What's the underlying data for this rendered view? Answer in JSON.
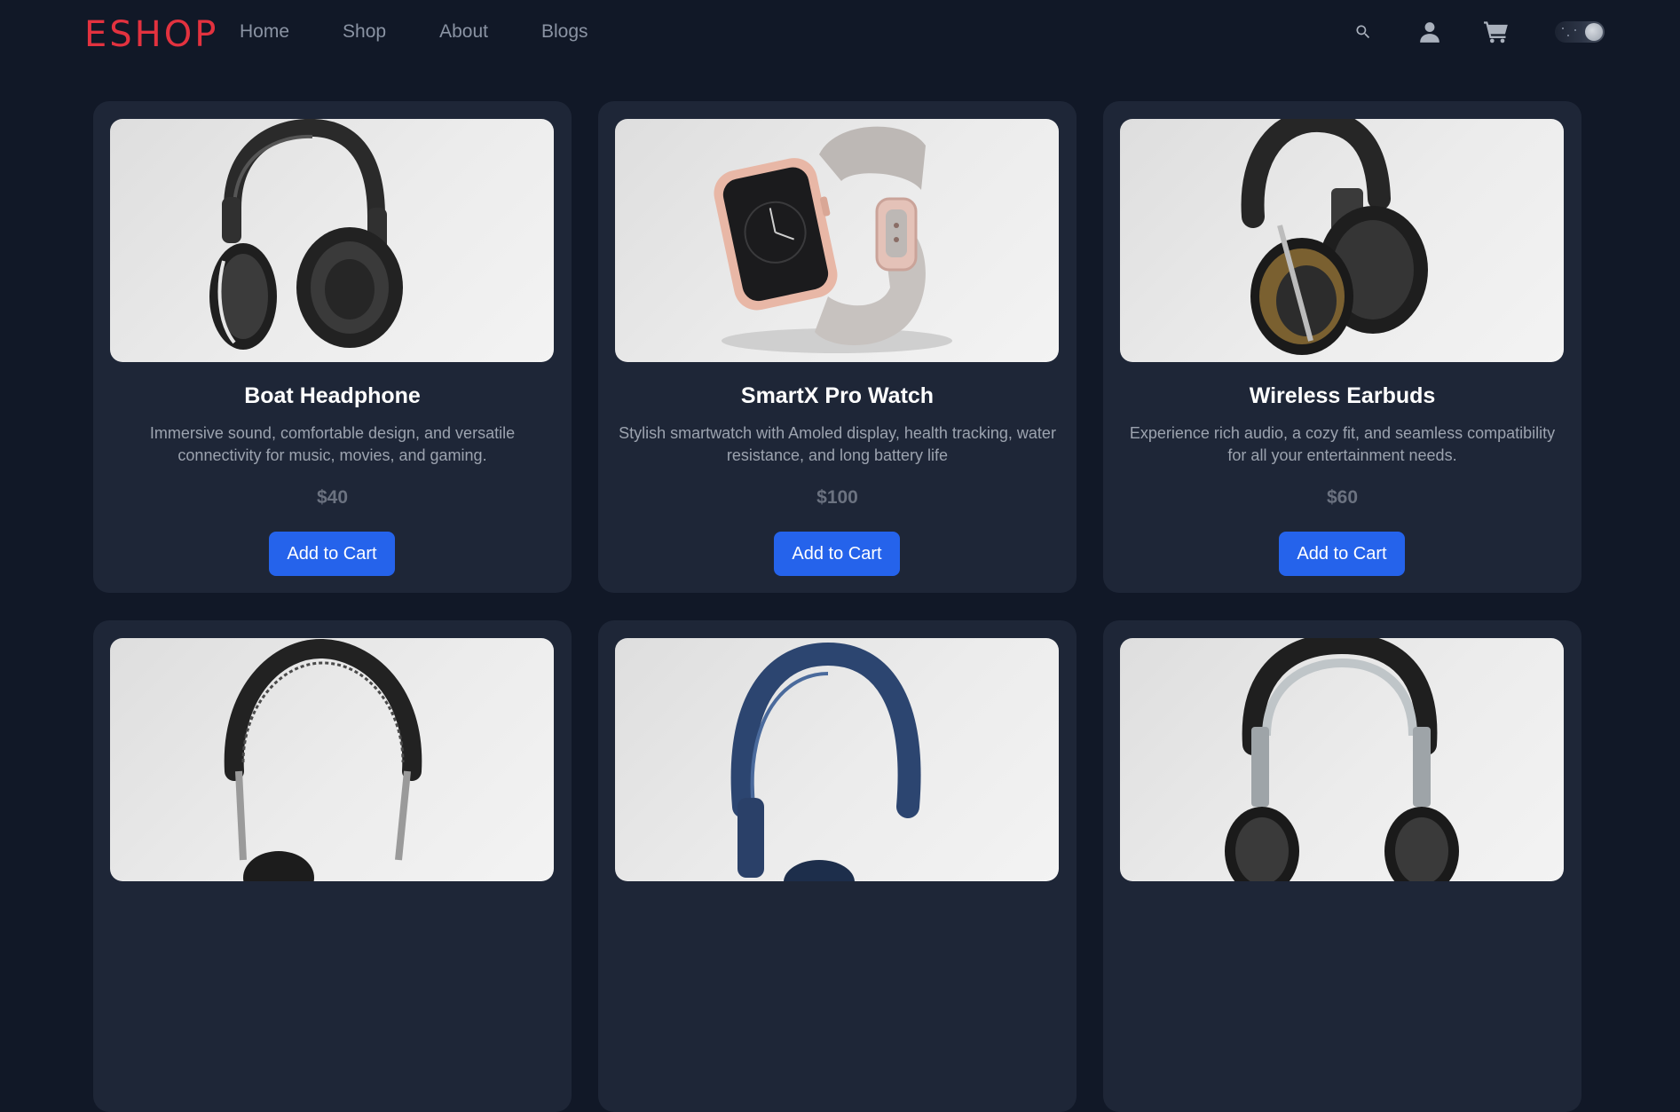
{
  "brand": "ESHOP",
  "nav": {
    "links": [
      "Home",
      "Shop",
      "About",
      "Blogs"
    ],
    "icons": [
      "search-icon",
      "user-icon",
      "cart-icon",
      "theme-toggle"
    ]
  },
  "colors": {
    "page_background": "#111827",
    "card_background": "#1e2637",
    "brand": "#e3323f",
    "button": "#2563eb"
  },
  "products": [
    {
      "name": "Boat Headphone",
      "description": "Immersive sound, comfortable design, and versatile connectivity for music, movies, and gaming.",
      "price": "$40",
      "button": "Add to Cart",
      "image": "black-over-ear-headphones"
    },
    {
      "name": "SmartX Pro Watch",
      "description": "Stylish smartwatch with Amoled display, health tracking, water resistance, and long battery life",
      "price": "$100",
      "button": "Add to Cart",
      "image": "rose-gold-smartwatch"
    },
    {
      "name": "Wireless Earbuds",
      "description": "Experience rich audio, a cozy fit, and seamless compatibility for all your entertainment needs.",
      "price": "$60",
      "button": "Add to Cart",
      "image": "black-gold-headphones"
    },
    {
      "image": "black-leather-headphones"
    },
    {
      "image": "navy-blue-headphones"
    },
    {
      "image": "silver-dj-headphones"
    }
  ]
}
